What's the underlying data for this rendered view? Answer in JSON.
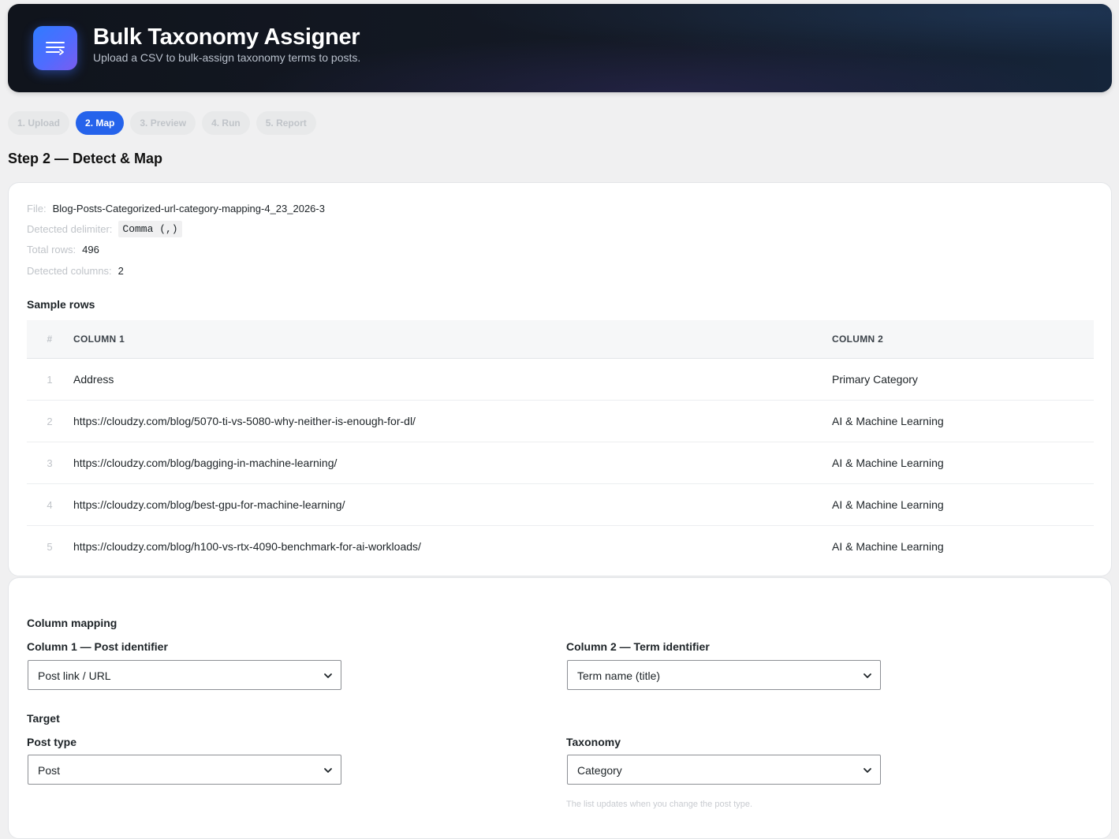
{
  "header": {
    "title": "Bulk Taxonomy Assigner",
    "subtitle": "Upload a CSV to bulk-assign taxonomy terms to posts."
  },
  "steps": [
    {
      "label": "1. Upload",
      "active": false
    },
    {
      "label": "2. Map",
      "active": true
    },
    {
      "label": "3. Preview",
      "active": false
    },
    {
      "label": "4. Run",
      "active": false
    },
    {
      "label": "5. Report",
      "active": false
    }
  ],
  "step_heading": "Step 2 — Detect & Map",
  "file_info": {
    "file_label": "File:",
    "file_value": "Blog-Posts-Categorized-url-category-mapping-4_23_2026-3",
    "delimiter_label": "Detected delimiter:",
    "delimiter_value": "Comma (,)",
    "rows_label": "Total rows:",
    "rows_value": "496",
    "columns_label": "Detected columns:",
    "columns_value": "2"
  },
  "sample": {
    "title": "Sample rows",
    "headers": [
      "#",
      "COLUMN 1",
      "COLUMN 2"
    ],
    "rows": [
      [
        "1",
        "Address",
        "Primary Category"
      ],
      [
        "2",
        "https://cloudzy.com/blog/5070-ti-vs-5080-why-neither-is-enough-for-dl/",
        "AI & Machine Learning"
      ],
      [
        "3",
        "https://cloudzy.com/blog/bagging-in-machine-learning/",
        "AI & Machine Learning"
      ],
      [
        "4",
        "https://cloudzy.com/blog/best-gpu-for-machine-learning/",
        "AI & Machine Learning"
      ],
      [
        "5",
        "https://cloudzy.com/blog/h100-vs-rtx-4090-benchmark-for-ai-workloads/",
        "AI & Machine Learning"
      ]
    ]
  },
  "mapping": {
    "title": "Column mapping",
    "col1_label": "Column 1 — Post identifier",
    "col1_value": "Post link / URL",
    "col2_label": "Column 2 — Term identifier",
    "col2_value": "Term name (title)"
  },
  "target": {
    "title": "Target",
    "post_type_label": "Post type",
    "post_type_value": "Post",
    "taxonomy_label": "Taxonomy",
    "taxonomy_value": "Category",
    "taxonomy_hint": "The list updates when you change the post type."
  },
  "colors": {
    "accent": "#2563eb",
    "header_bg": "#10141c"
  }
}
